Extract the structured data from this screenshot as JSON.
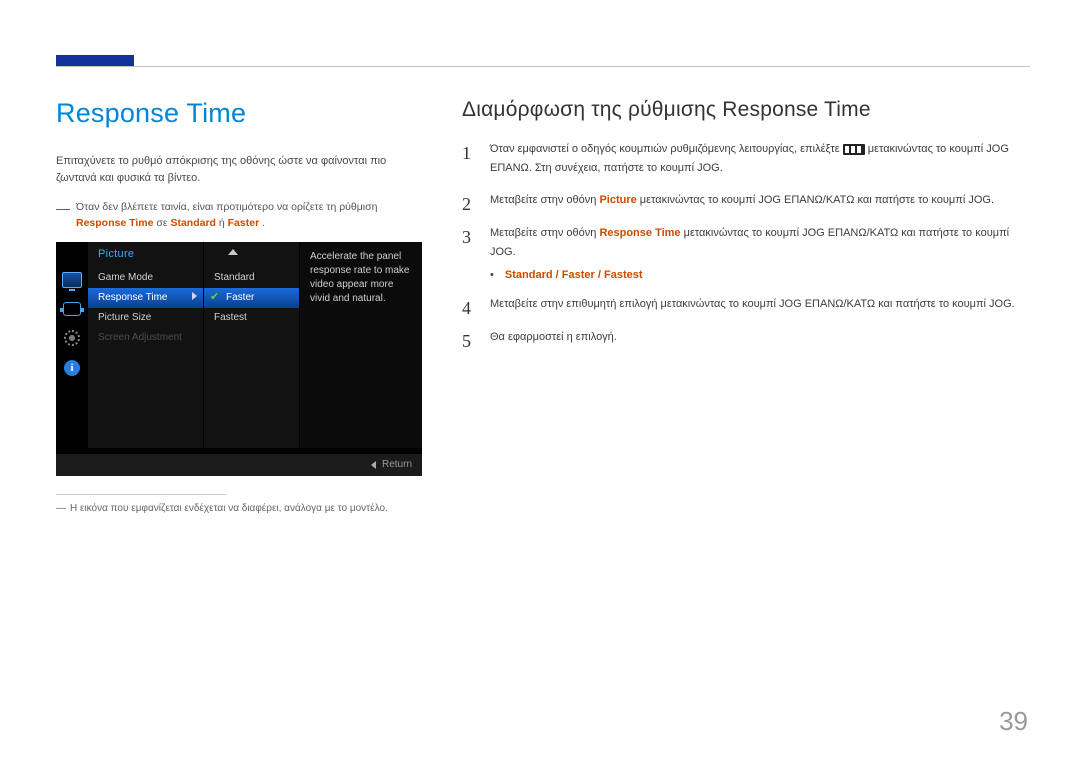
{
  "header": {},
  "left": {
    "title": "Response Time",
    "intro": "Επιταχύνετε το ρυθμό απόκρισης της οθόνης ώστε να φαίνονται πιο ζωντανά και φυσικά τα βίντεο.",
    "note_prefix": "Όταν δεν βλέπετε ταινία, είναι προτιμότερο να ορίζετε τη ρύθμιση ",
    "note_bold1": "Response Time",
    "note_mid": " σε ",
    "note_bold2": "Standard",
    "note_or": " ή ",
    "note_bold3": "Faster",
    "note_end": ".",
    "footnote": "Η εικόνα που εμφανίζεται ενδέχεται να διαφέρει, ανάλογα με το μοντέλο."
  },
  "osd": {
    "category": "Picture",
    "items": [
      "Game Mode",
      "Response Time",
      "Picture Size",
      "Screen Adjustment"
    ],
    "options": [
      "Standard",
      "Faster",
      "Fastest"
    ],
    "desc": "Accelerate the panel response rate to make video appear more vivid and natural.",
    "return": "Return"
  },
  "right": {
    "subtitle": "Διαμόρφωση της ρύθμισης Response Time",
    "step1_a": "Όταν εμφανιστεί ο οδηγός κουμπιών ρυθμιζόμενης λειτουργίας, επιλέξτε ",
    "step1_b": " μετακινώντας το κουμπί JOG ΕΠΑΝΩ. Στη συνέχεια, πατήστε το κουμπί JOG.",
    "step2_a": "Μεταβείτε στην οθόνη ",
    "step2_pic": "Picture",
    "step2_b": " μετακινώντας το κουμπί JOG ΕΠΑΝΩ/ΚΑΤΩ και πατήστε το κουμπί JOG.",
    "step3_a": "Μεταβείτε στην οθόνη ",
    "step3_rt": "Response Time",
    "step3_b": " μετακινώντας το κουμπί JOG ΕΠΑΝΩ/ΚΑΤΩ και πατήστε το κουμπί JOG.",
    "bullet_a": "Standard",
    "bullet_sep1": " / ",
    "bullet_b": "Faster",
    "bullet_sep2": " / ",
    "bullet_c": "Fastest",
    "step4": "Μεταβείτε στην επιθυμητή επιλογή μετακινώντας το κουμπί JOG ΕΠΑΝΩ/ΚΑΤΩ και πατήστε το κουμπί JOG.",
    "step5": "Θα εφαρμοστεί η επιλογή.",
    "nums": [
      "1",
      "2",
      "3",
      "4",
      "5"
    ]
  },
  "page_number": "39"
}
